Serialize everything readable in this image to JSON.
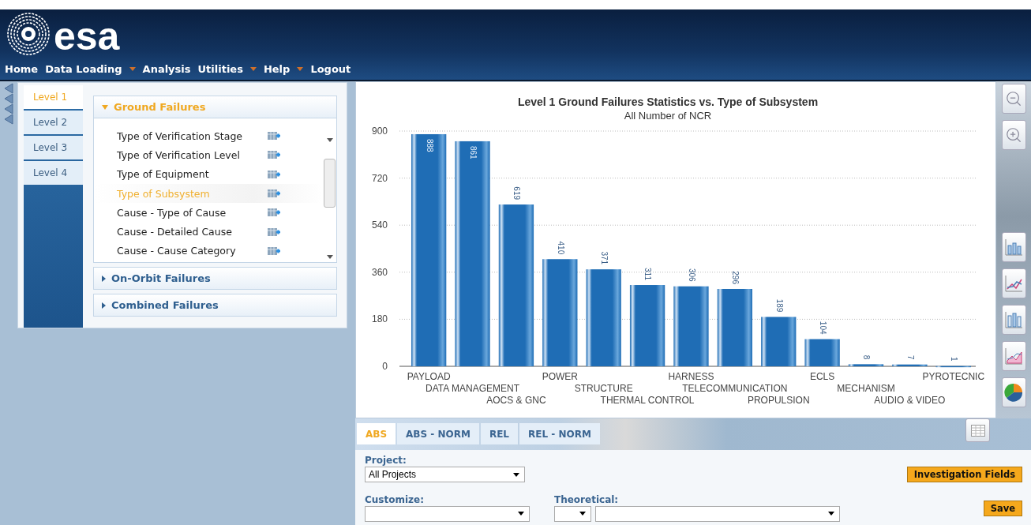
{
  "header": {
    "logo": "esa",
    "menu": [
      {
        "label": "Home",
        "has_dropdown": false
      },
      {
        "label": "Data Loading",
        "has_dropdown": true
      },
      {
        "label": "Analysis",
        "has_dropdown": false
      },
      {
        "label": "Utilities",
        "has_dropdown": true
      },
      {
        "label": "Help",
        "has_dropdown": true
      },
      {
        "label": "Logout",
        "has_dropdown": false
      }
    ]
  },
  "levels": [
    {
      "label": "Level 1",
      "selected": true
    },
    {
      "label": "Level 2",
      "selected": false
    },
    {
      "label": "Level 3",
      "selected": false
    },
    {
      "label": "Level 4",
      "selected": false
    }
  ],
  "accordion": [
    {
      "title": "Ground Failures",
      "expanded": true,
      "items": [
        {
          "label": "Type of Verification Stage",
          "selected": false
        },
        {
          "label": "Type of Verification Level",
          "selected": false
        },
        {
          "label": "Type of Equipment",
          "selected": false
        },
        {
          "label": "Type of Subsystem",
          "selected": true
        },
        {
          "label": "Cause - Type of Cause",
          "selected": false
        },
        {
          "label": "Cause - Detailed Cause",
          "selected": false
        },
        {
          "label": "Cause - Cause Category",
          "selected": false
        }
      ]
    },
    {
      "title": "On-Orbit Failures",
      "expanded": false
    },
    {
      "title": "Combined Failures",
      "expanded": false
    }
  ],
  "chart": {
    "subtitle": "All Number of NCR",
    "chart_data": {
      "type": "bar",
      "title": "Level 1 Ground Failures Statistics vs. Type of Subsystem",
      "categories": [
        "PAYLOAD",
        "DATA MANAGEMENT",
        "AOCS & GNC",
        "POWER",
        "STRUCTURE",
        "THERMAL CONTROL",
        "HARNESS",
        "TELECOMMUNICATION",
        "PROPULSION",
        "ECLS",
        "MECHANISM",
        "AUDIO & VIDEO",
        "PYROTECNIC"
      ],
      "series": [
        {
          "color": "#1f6db5",
          "values": [
            888,
            861,
            619,
            410,
            371,
            311,
            306,
            296,
            189,
            104,
            8,
            7,
            1
          ]
        }
      ],
      "ylim": [
        0,
        900
      ],
      "yticks": [
        0,
        180,
        360,
        540,
        720,
        900
      ],
      "data_labels": true,
      "grid": true
    }
  },
  "view_tabs": [
    {
      "label": "ABS",
      "selected": true
    },
    {
      "label": "ABS - NORM",
      "selected": false
    },
    {
      "label": "REL",
      "selected": false
    },
    {
      "label": "REL - NORM",
      "selected": false
    }
  ],
  "form": {
    "project": {
      "label": "Project:",
      "value": "All Projects"
    },
    "investigation_button": "Investigation Fields",
    "customize": {
      "label": "Customize:"
    },
    "theoretical": {
      "label": "Theoretical:"
    },
    "save_button": "Save"
  }
}
